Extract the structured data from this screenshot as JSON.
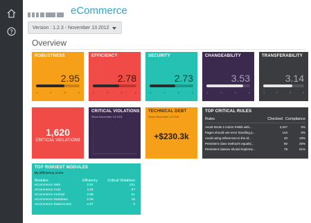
{
  "app": {
    "name": "eCommerce"
  },
  "version_selector": {
    "label": "Version : 1.2.3 - November 13 2012"
  },
  "section_title": "Overview",
  "colors": {
    "accent": "#2aa7d6",
    "orange": "#f6a01a",
    "red": "#f04b46",
    "teal": "#25c2b3",
    "purple": "#3b2a4e",
    "dark": "#3a3c40"
  },
  "tiles": [
    {
      "title": "ROBUSTNESS",
      "value": "2.95",
      "ticks": [
        "1",
        "2",
        "3",
        "4"
      ],
      "level": 0.65
    },
    {
      "title": "EFFICIENCY",
      "value": "2.78",
      "ticks": [
        "1",
        "2",
        "3",
        "4"
      ],
      "level": 0.6
    },
    {
      "title": "SECURITY",
      "value": "2.73",
      "ticks": [
        "1",
        "2",
        "3",
        "4"
      ],
      "level": 0.58
    },
    {
      "title": "CHANGEABILITY",
      "value": "3.53",
      "ticks": [
        "1",
        "2",
        "3",
        "4"
      ],
      "level": 0.84
    },
    {
      "title": "TRANSFERABILITY",
      "value": "3.14",
      "ticks": [
        "1",
        "2",
        "3",
        "4"
      ],
      "level": 0.71
    }
  ],
  "critical_tile": {
    "value": "1,620",
    "label": "CRITICAL VIOLATIONS"
  },
  "violations_tile": {
    "title": "CRITICAL VIOLATIONS",
    "subtitle": "Since November 13 2011"
  },
  "tech_debt_tile": {
    "title": "TECHNICAL DEBT",
    "subtitle": "Since November 13 2011",
    "value": "+$230.3k"
  },
  "top_rules": {
    "title": "TOP CRITICAL RULES",
    "headers": [
      "Rules",
      "Checked",
      "Compliance"
    ],
    "rows": [
      [
        "Avoid Struts 2 Action Fields with...",
        "2,047",
        "0%"
      ],
      [
        "Pages should use error handling p...",
        "143",
        "0%"
      ],
      [
        "Avoid using references to the id...",
        "40",
        "19%"
      ],
      [
        "Persistent class method's equals(...",
        "80",
        "25%"
      ],
      [
        "Persistent classes should impleme...",
        "78",
        "51%"
      ]
    ]
  },
  "top_modules": {
    "title": "TOP RISKIEST MODULES",
    "subtitle": "By Efficiency score",
    "headers": [
      "Modules",
      "Efficiency",
      "Critical Violations"
    ],
    "rows": [
      [
        "eCommerce Web",
        "2.61",
        "221"
      ],
      [
        "eCommerce Core",
        "3.28",
        "67"
      ],
      [
        "eCommerce Central",
        "2.86",
        "51"
      ],
      [
        "eCommerce Database",
        "2.26",
        "15"
      ],
      [
        "eCommerce DataAccess",
        "2.87",
        "0"
      ]
    ]
  },
  "icons": {
    "home": "home-icon",
    "help": "help-icon"
  }
}
